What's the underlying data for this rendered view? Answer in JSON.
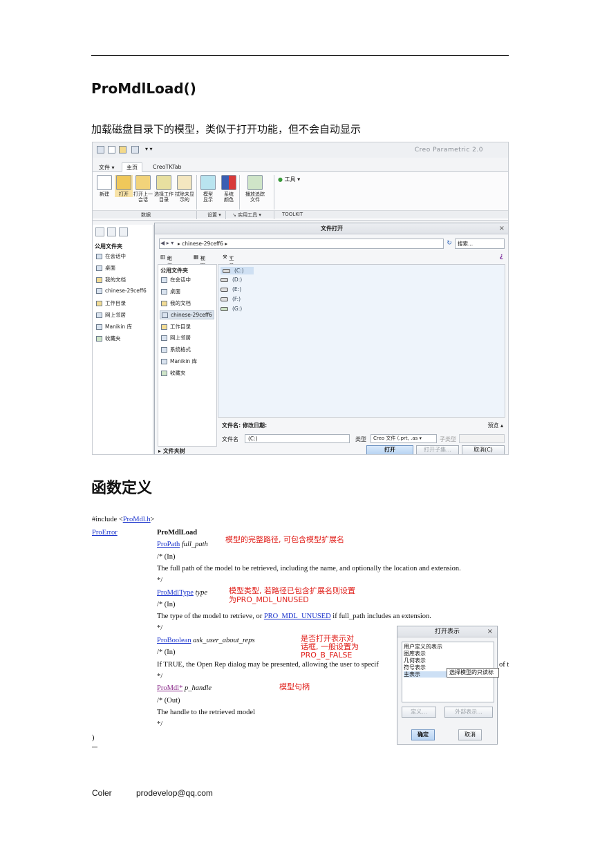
{
  "heading": "ProMdlLoad()",
  "description": "加载磁盘目录下的模型，类似于打开功能，但不会自动显示",
  "section_heading": "函数定义",
  "screenshot": {
    "app_title": "Creo Parametric 2.0",
    "tabs": [
      "文件",
      "主页",
      "CreoTKTab"
    ],
    "ribbon_buttons": [
      "新建",
      "打开",
      "打开上一会话",
      "选择工作目录",
      "拭除未显示的",
      "模型显示",
      "系统颜色",
      "播放追踪文件"
    ],
    "tools_label": "工具",
    "groups": [
      "数据",
      "设置",
      "实用工具",
      "TOOLKIT"
    ],
    "navigator": {
      "header": "公用文件夹",
      "items": [
        "在会话中",
        "桌面",
        "我的文档",
        "chinese-29ceff6",
        "工作目录",
        "网上邻居",
        "Manikin 库",
        "收藏夹"
      ]
    },
    "dialog": {
      "title": "文件打开",
      "address": "chinese-29ceff6",
      "search_placeholder": "搜索...",
      "toolbar": [
        "组织",
        "视图",
        "工具"
      ],
      "left_header": "公用文件夹",
      "left_items": [
        "在会话中",
        "桌面",
        "我的文档",
        "chinese-29ceff6",
        "工作目录",
        "网上邻居",
        "系统格式",
        "Manikin 库",
        "收藏夹"
      ],
      "drives": [
        "(C:)",
        "(D:)",
        "(E:)",
        "(F:)",
        "(G:)"
      ],
      "file_info": "文件名: 修改日期:",
      "preview": "预览",
      "filename_label": "文件名",
      "filename_value": "(C:)",
      "type_label": "类型",
      "type_value": "Creo 文件 (.prt, .as",
      "subtype_label": "子类型",
      "buttons": [
        "打开",
        "打开子集...",
        "取消(C)"
      ],
      "folder_tree": "文件夹树"
    }
  },
  "code": {
    "include_prefix": "#include <",
    "include_link": "ProMdl.h",
    "include_suffix": ">",
    "return_type": "ProError",
    "func_name": "ProMdlLoad",
    "lines": [
      {
        "type": "ProPath",
        "name": "full_path",
        "dir": "/* (In)",
        "desc": "The full path of the model to be retrieved, including the name, and optionally the location and extension.",
        "close": "*/"
      },
      {
        "type": "ProMdlType",
        "name": "type",
        "dir": "/* (In)",
        "desc_a": "The type of the model to retrieve, or ",
        "desc_link": "PRO_MDL_UNUSED",
        "desc_b": " if full_path includes an extension.",
        "close": "*/"
      },
      {
        "type": "ProBoolean",
        "name": "ask_user_about_reps",
        "dir": "/* (In)",
        "desc_a": "If TRUE, the Open Rep dialog may be presented, allowing the user to specif",
        "desc_b": "of t",
        "close": "*/"
      },
      {
        "type": "ProMdl*",
        "name": "p_handle",
        "dir": "/* (Out)",
        "desc": "The handle to the retrieved model",
        "close": "*/"
      }
    ],
    "closing": ")"
  },
  "annotations": {
    "full_path": "模型的完整路径, 可包含模型扩展名",
    "type_1": "模型类型, 若路径已包含扩展名则设置",
    "type_2": "为PRO_MDL_UNUSED",
    "reps_1": "是否打开表示对",
    "reps_2": "话框, 一般设置为",
    "reps_3": "PRO_B_FALSE",
    "handle": "模型句柄"
  },
  "popup": {
    "title": "打开表示",
    "items": [
      "用户定义的表示",
      "图库表示",
      "几何表示",
      "符号表示",
      "主表示"
    ],
    "tooltip": "选择模型的只读标",
    "buttons": [
      "定义...",
      "外部表示...",
      "确定",
      "取消"
    ]
  },
  "footer": {
    "name": "Coler",
    "email": "prodevelop@qq.com"
  }
}
